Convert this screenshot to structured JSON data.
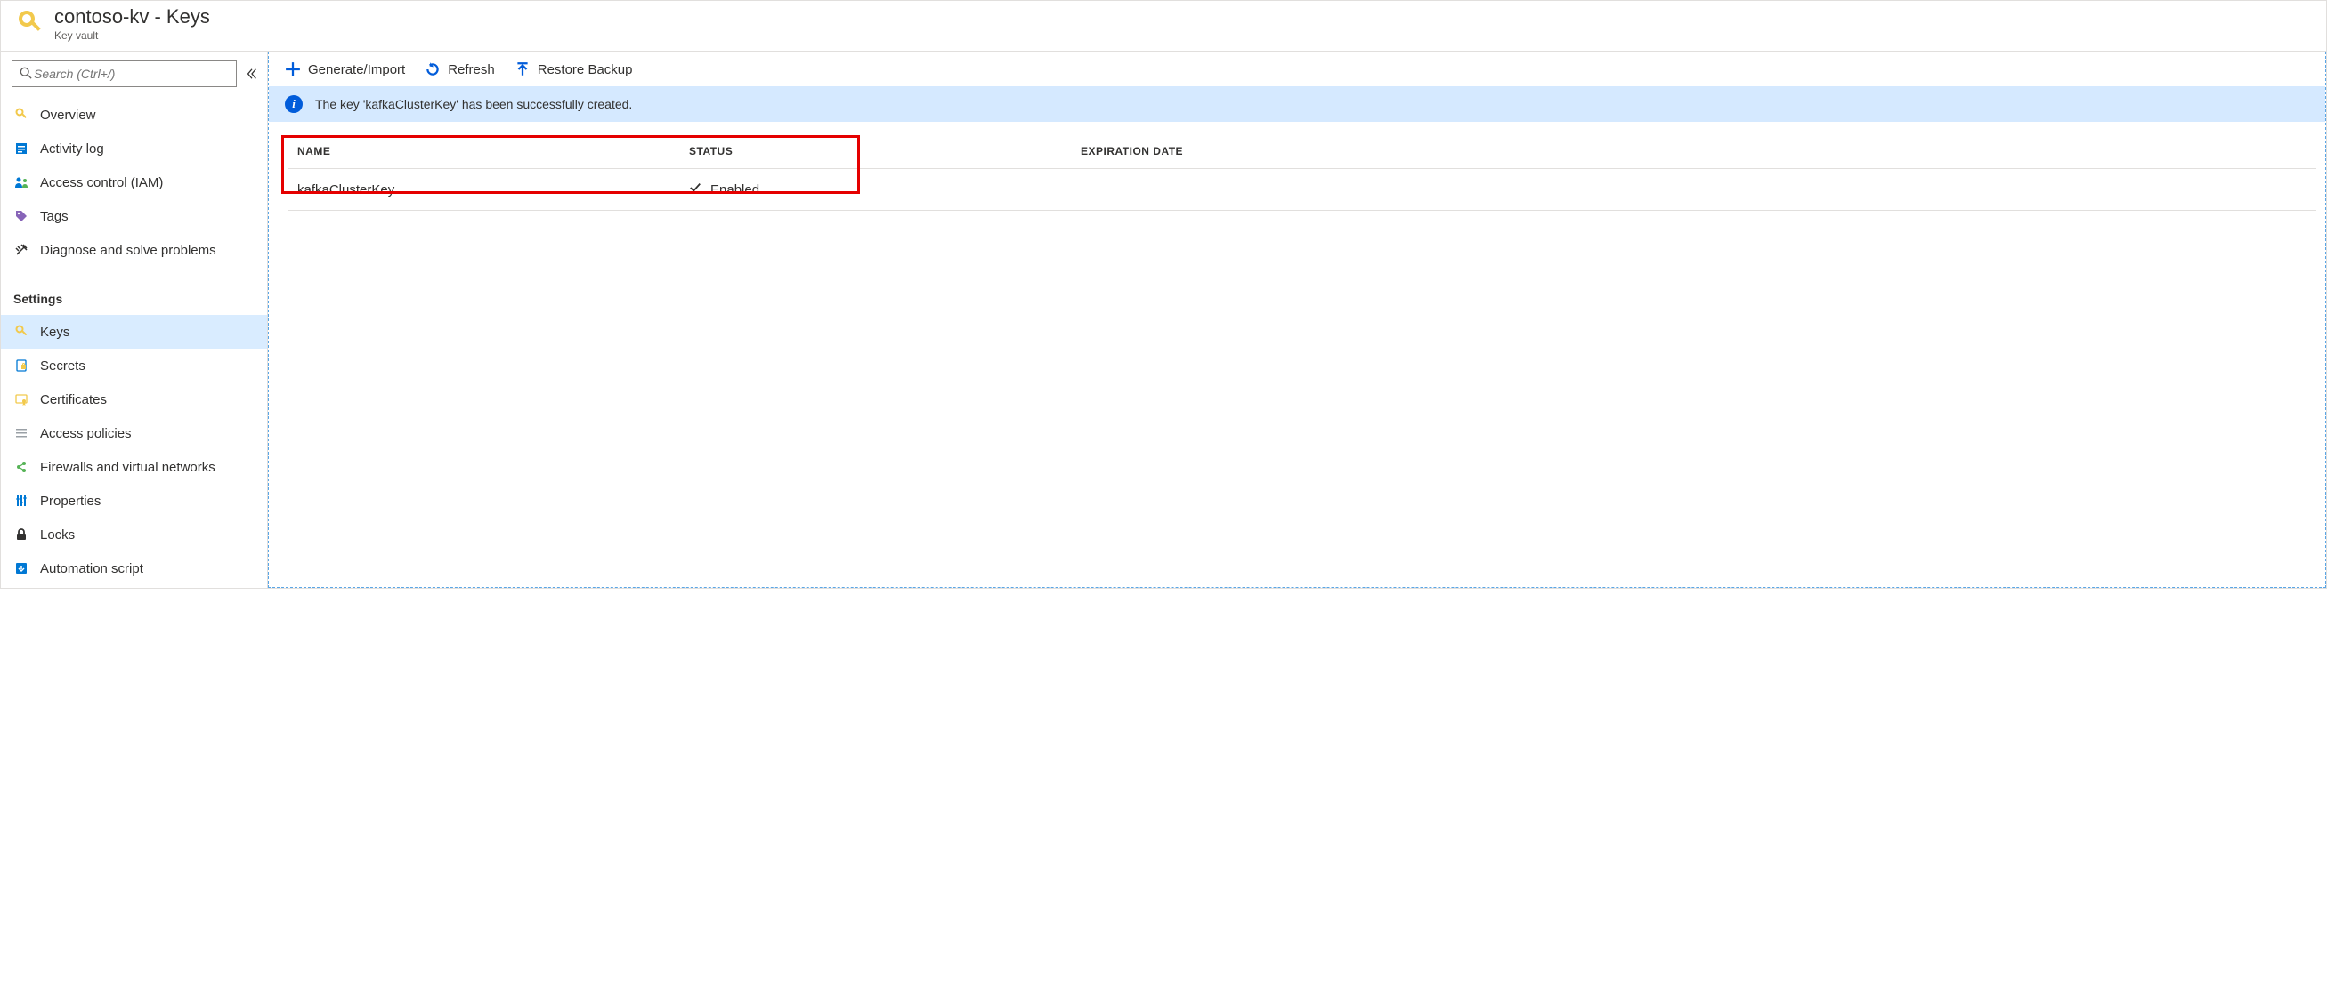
{
  "header": {
    "title": "contoso-kv - Keys",
    "subtitle": "Key vault"
  },
  "sidebar": {
    "search_placeholder": "Search (Ctrl+/)",
    "items_top": [
      {
        "id": "overview",
        "label": "Overview"
      },
      {
        "id": "activity-log",
        "label": "Activity log"
      },
      {
        "id": "access-control",
        "label": "Access control (IAM)"
      },
      {
        "id": "tags",
        "label": "Tags"
      },
      {
        "id": "diagnose",
        "label": "Diagnose and solve problems"
      }
    ],
    "section_settings_header": "Settings",
    "items_settings": [
      {
        "id": "keys",
        "label": "Keys",
        "active": true
      },
      {
        "id": "secrets",
        "label": "Secrets"
      },
      {
        "id": "certificates",
        "label": "Certificates"
      },
      {
        "id": "access-policies",
        "label": "Access policies"
      },
      {
        "id": "firewalls",
        "label": "Firewalls and virtual networks"
      },
      {
        "id": "properties",
        "label": "Properties"
      },
      {
        "id": "locks",
        "label": "Locks"
      },
      {
        "id": "automation-script",
        "label": "Automation script"
      }
    ]
  },
  "toolbar": {
    "generate_label": "Generate/Import",
    "refresh_label": "Refresh",
    "restore_label": "Restore Backup"
  },
  "notification": {
    "message": "The key 'kafkaClusterKey' has been successfully created."
  },
  "table": {
    "headers": {
      "name": "NAME",
      "status": "STATUS",
      "expiration": "EXPIRATION DATE"
    },
    "rows": [
      {
        "name": "kafkaClusterKey",
        "status": "Enabled",
        "expiration": ""
      }
    ]
  }
}
